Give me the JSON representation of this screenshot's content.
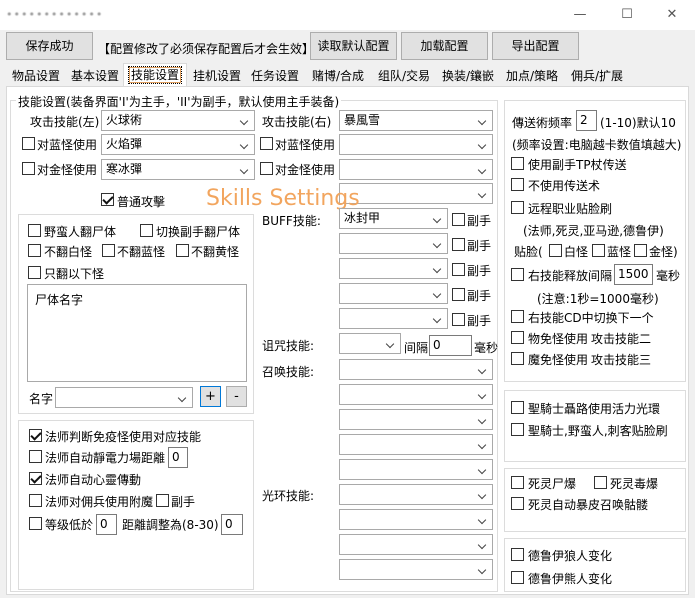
{
  "window": {
    "title": "•••••••••••••",
    "minimize": "—",
    "maximize": "☐",
    "close": "✕"
  },
  "toolbar": {
    "save": "保存成功",
    "notice": "【配置修改了必须保存配置后才会生效】",
    "load_default": "读取默认配置",
    "load": "加载配置",
    "export": "导出配置"
  },
  "tabs": [
    "物品设置",
    "基本设置",
    "技能设置",
    "挂机设置",
    "任务设置",
    "赌博/合成",
    "组队/交易",
    "换装/鑲嵌",
    "加点/策略",
    "佣兵/扩展"
  ],
  "active_tab": "技能设置",
  "watermark": "Skills Settings",
  "skills": {
    "group_title": "技能设置(装备界面'I'为主手，'II'为副手，默认使用主手装备)",
    "attack_left_label": "攻击技能(左)",
    "attack_left_value": "火球術",
    "attack_right_label": "攻击技能(右)",
    "attack_right_value": "暴風雪",
    "vs_blue_label": "对蓝怪使用",
    "vs_blue_value": "火焰彈",
    "vs_gold_label": "对金怪使用",
    "vs_gold_value": "寒冰彈",
    "normal_attack": "普通攻擊",
    "buff_label": "BUFF技能:",
    "buff_value": "冰封甲",
    "offhand": "副手",
    "curse_label": "诅咒技能:",
    "curse_interval_label": "间隔",
    "curse_interval_value": "0",
    "curse_unit": "毫秒",
    "summon_label": "召唤技能:",
    "aura_label": "光环技能:"
  },
  "corpse": {
    "barbarian": "野蛮人翻尸体",
    "switch_offhand": "切换副手翻尸体",
    "no_white": "不翻白怪",
    "no_blue": "不翻蓝怪",
    "no_yellow": "不翻黄怪",
    "only_below": "只翻以下怪",
    "list_header": "尸体名字",
    "name_label": "名字",
    "add": "+",
    "remove": "-"
  },
  "mage": {
    "immune_switch": "法师判断免疫怪使用对应技能",
    "auto_static": "法师自动靜電力場距離",
    "auto_static_value": "0",
    "auto_telekinesis": "法师自动心靈傳動",
    "merc_enchant": "法师对佣兵使用附魔",
    "offhand": "副手",
    "level_below": "等级低於",
    "level_value": "0",
    "distance_adjust": "距離調整為(8-30)",
    "distance_value": "0"
  },
  "right": {
    "teleport_freq_label": "傳送術频率",
    "teleport_freq_value": "2",
    "teleport_freq_hint": "(1-10)默认10",
    "freq_note": "(频率设置:电脑越卡数值填越大)",
    "use_offhand_tp": "使用副手TP杖传送",
    "no_teleport": "不使用传送术",
    "ranged_face": "远程职业贴脸刷",
    "classes_note": "(法师,死灵,亚马逊,德鲁伊)",
    "face_label": "贴脸(",
    "white": "白怪",
    "blue": "蓝怪",
    "gold": "金怪)",
    "right_interval_label": "右技能释放间隔",
    "right_interval_value": "1500",
    "ms": "毫秒",
    "ms_note": "(注意:1秒=1000毫秒)",
    "cd_switch": "右技能CD中切换下一个",
    "phys_immune": "物免怪使用",
    "phys_skill": "攻击技能二",
    "magic_immune": "魔免怪使用",
    "magic_skill": "攻击技能三"
  },
  "paladin": {
    "vigor": "聖騎士聶路使用活力光環",
    "face": "聖騎士,野蛮人,刺客贴脸刷"
  },
  "necro": {
    "corpse_explosion": "死灵尸爆",
    "poison_nova": "死灵毒爆",
    "auto_revive": "死灵自动暴皮召唤骷髅"
  },
  "druid": {
    "werewolf": "德鲁伊狼人变化",
    "werebear": "德鲁伊熊人变化"
  },
  "state": {
    "normal_attack": true,
    "immune_switch": true,
    "auto_telekinesis": true
  }
}
